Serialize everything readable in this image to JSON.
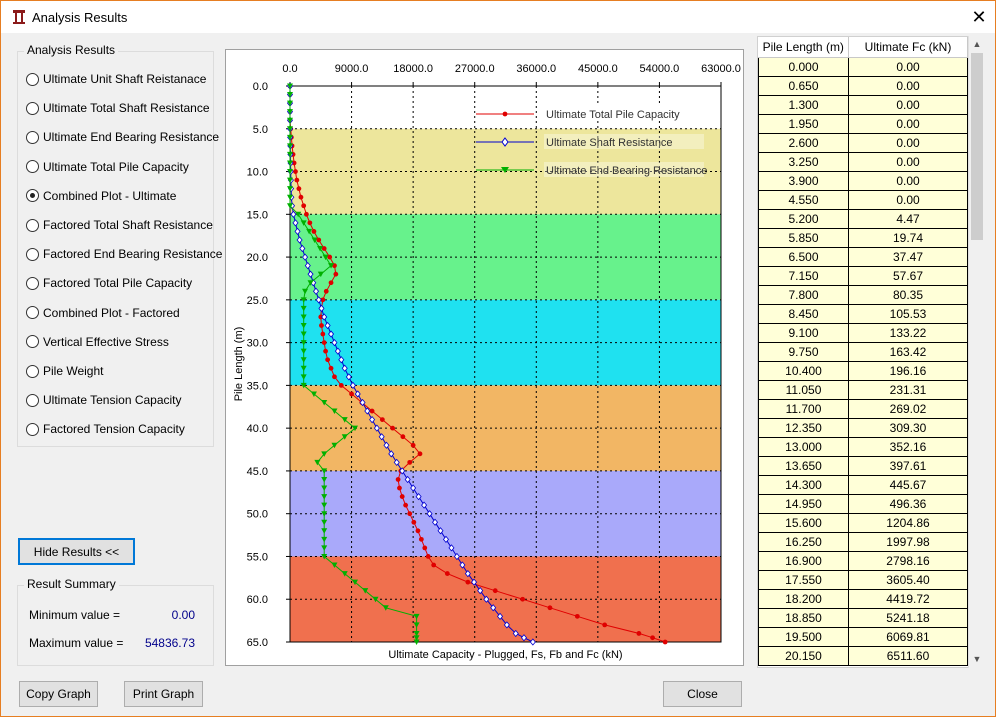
{
  "window": {
    "title": "Analysis Results",
    "close_glyph": "✕"
  },
  "results_group": {
    "legend": "Analysis Results",
    "options": [
      {
        "label": "Ultimate Unit Shaft Reistanace",
        "checked": false
      },
      {
        "label": "Ultimate Total Shaft Resistance",
        "checked": false
      },
      {
        "label": "Ultimate End Bearing Resistance",
        "checked": false
      },
      {
        "label": "Ultimate Total Pile Capacity",
        "checked": false
      },
      {
        "label": "Combined Plot - Ultimate",
        "checked": true
      },
      {
        "label": "Factored Total Shaft Resistance",
        "checked": false
      },
      {
        "label": "Factored End Bearing Resistance",
        "checked": false
      },
      {
        "label": "Factored Total Pile Capacity",
        "checked": false
      },
      {
        "label": "Combined Plot - Factored",
        "checked": false
      },
      {
        "label": "Vertical Effective Stress",
        "checked": false
      },
      {
        "label": "Pile Weight",
        "checked": false
      },
      {
        "label": "Ultimate Tension Capacity",
        "checked": false
      },
      {
        "label": "Factored Tension Capacity",
        "checked": false
      }
    ]
  },
  "hide_results_button": "Hide Results <<",
  "summary": {
    "legend": "Result Summary",
    "min_label": "Minimum value =",
    "min_value": "0.00",
    "max_label": "Maximum value =",
    "max_value": "54836.73"
  },
  "buttons": {
    "copy": "Copy Graph",
    "print": "Print Graph",
    "close": "Close"
  },
  "table": {
    "headers": [
      "Pile Length (m)",
      "Ultimate Fc (kN)"
    ],
    "rows": [
      [
        "0.000",
        "0.00"
      ],
      [
        "0.650",
        "0.00"
      ],
      [
        "1.300",
        "0.00"
      ],
      [
        "1.950",
        "0.00"
      ],
      [
        "2.600",
        "0.00"
      ],
      [
        "3.250",
        "0.00"
      ],
      [
        "3.900",
        "0.00"
      ],
      [
        "4.550",
        "0.00"
      ],
      [
        "5.200",
        "4.47"
      ],
      [
        "5.850",
        "19.74"
      ],
      [
        "6.500",
        "37.47"
      ],
      [
        "7.150",
        "57.67"
      ],
      [
        "7.800",
        "80.35"
      ],
      [
        "8.450",
        "105.53"
      ],
      [
        "9.100",
        "133.22"
      ],
      [
        "9.750",
        "163.42"
      ],
      [
        "10.400",
        "196.16"
      ],
      [
        "11.050",
        "231.31"
      ],
      [
        "11.700",
        "269.02"
      ],
      [
        "12.350",
        "309.30"
      ],
      [
        "13.000",
        "352.16"
      ],
      [
        "13.650",
        "397.61"
      ],
      [
        "14.300",
        "445.67"
      ],
      [
        "14.950",
        "496.36"
      ],
      [
        "15.600",
        "1204.86"
      ],
      [
        "16.250",
        "1997.98"
      ],
      [
        "16.900",
        "2798.16"
      ],
      [
        "17.550",
        "3605.40"
      ],
      [
        "18.200",
        "4419.72"
      ],
      [
        "18.850",
        "5241.18"
      ],
      [
        "19.500",
        "6069.81"
      ],
      [
        "20.150",
        "6511.60"
      ]
    ]
  },
  "chart_data": {
    "type": "line",
    "xlabel": "Ultimate Capacity - Plugged, Fs, Fb and Fc (kN)",
    "ylabel": "Pile Length (m)",
    "x_axis_position": "top",
    "y_inverted": true,
    "xlim": [
      0,
      63000
    ],
    "ylim": [
      0,
      65
    ],
    "x_ticks": [
      "0.0",
      "9000.0",
      "18000.0",
      "27000.0",
      "36000.0",
      "45000.0",
      "54000.0",
      "63000.0"
    ],
    "y_ticks": [
      "0.0",
      "5.0",
      "10.0",
      "15.0",
      "20.0",
      "25.0",
      "30.0",
      "35.0",
      "40.0",
      "45.0",
      "50.0",
      "55.0",
      "60.0",
      "65.0"
    ],
    "grid": "dashed",
    "legend_placement": "top-right",
    "layers": [
      {
        "from": 0,
        "to": 5,
        "color": "#ffffff"
      },
      {
        "from": 5,
        "to": 15,
        "color": "#ede69c"
      },
      {
        "from": 15,
        "to": 25,
        "color": "#67f28c"
      },
      {
        "from": 25,
        "to": 35,
        "color": "#1fe1f0"
      },
      {
        "from": 35,
        "to": 45,
        "color": "#f2b664"
      },
      {
        "from": 45,
        "to": 55,
        "color": "#a9a9fa"
      },
      {
        "from": 55,
        "to": 65,
        "color": "#f0704e"
      }
    ],
    "series": [
      {
        "name": "Ultimate Total Pile Capacity",
        "color": "#e00000",
        "marker": "circle",
        "x": [
          0,
          0,
          0,
          0,
          0,
          100,
          200,
          300,
          450,
          600,
          800,
          1000,
          1300,
          1600,
          2000,
          2400,
          2900,
          3500,
          4200,
          5000,
          5800,
          6500,
          6700,
          6000,
          5300,
          4800,
          4600,
          4500,
          4600,
          4800,
          5000,
          5200,
          5500,
          6000,
          6500,
          7500,
          9000,
          10500,
          12000,
          13500,
          15000,
          16500,
          18000,
          19000,
          17500,
          16200,
          15800,
          16000,
          16400,
          16900,
          17500,
          18100,
          18700,
          19200,
          19700,
          20200,
          21000,
          23000,
          26000,
          30000,
          34000,
          38000,
          42000,
          46000,
          51000,
          53000,
          54836.73
        ],
        "y": [
          0,
          1,
          2,
          3,
          4,
          5,
          6,
          7,
          8,
          9,
          10,
          11,
          12,
          13,
          14,
          15,
          16,
          17,
          18,
          19,
          20,
          21,
          22,
          23,
          24,
          25,
          26,
          27,
          28,
          29,
          30,
          31,
          32,
          33,
          34,
          35,
          36,
          37,
          38,
          39,
          40,
          41,
          42,
          43,
          44,
          45,
          46,
          47,
          48,
          49,
          50,
          51,
          52,
          53,
          54,
          55,
          56,
          57,
          58,
          59,
          60,
          61,
          62,
          63,
          64,
          64.5,
          65
        ]
      },
      {
        "name": "Ultimate Shaft Resistance",
        "color": "#0000d0",
        "marker": "diamond",
        "x": [
          0,
          0,
          0,
          0,
          0,
          5,
          20,
          40,
          60,
          80,
          100,
          130,
          160,
          200,
          300,
          500,
          800,
          1100,
          1400,
          1800,
          2200,
          2600,
          3000,
          3400,
          3800,
          4200,
          4600,
          5000,
          5500,
          6000,
          6500,
          7000,
          7500,
          8000,
          8600,
          9200,
          9900,
          10600,
          11300,
          12000,
          12700,
          13400,
          14100,
          14800,
          15600,
          16400,
          17200,
          18000,
          18800,
          19600,
          20400,
          21200,
          22000,
          22800,
          23600,
          24400,
          25200,
          26000,
          26900,
          27800,
          28700,
          29700,
          30700,
          31700,
          33000,
          34200,
          35500
        ],
        "y": [
          0,
          1,
          2,
          3,
          4,
          5,
          6,
          7,
          8,
          9,
          10,
          11,
          12,
          13,
          14,
          15,
          16,
          17,
          18,
          19,
          20,
          21,
          22,
          23,
          24,
          25,
          26,
          27,
          28,
          29,
          30,
          31,
          32,
          33,
          34,
          35,
          36,
          37,
          38,
          39,
          40,
          41,
          42,
          43,
          44,
          45,
          46,
          47,
          48,
          49,
          50,
          51,
          52,
          53,
          54,
          55,
          56,
          57,
          58,
          59,
          60,
          61,
          62,
          63,
          64,
          64.5,
          65
        ]
      },
      {
        "name": "Ultimate End Bearing Resistance",
        "color": "#00b000",
        "marker": "triangle",
        "x": [
          0,
          0,
          0,
          0,
          0,
          0,
          0,
          0,
          0,
          0,
          0,
          0,
          0,
          0,
          0,
          1200,
          2000,
          2800,
          3600,
          4400,
          5200,
          6000,
          4500,
          3000,
          2200,
          2000,
          2000,
          2000,
          2000,
          2000,
          2000,
          2000,
          2000,
          2000,
          2000,
          2000,
          3500,
          5000,
          6500,
          8000,
          9500,
          8000,
          6500,
          5000,
          4000,
          5000,
          5000,
          5000,
          5000,
          5000,
          5000,
          5000,
          5000,
          5000,
          5000,
          5000,
          6500,
          8000,
          9500,
          11000,
          12500,
          14000,
          18500,
          18500,
          18500,
          18500,
          18500
        ],
        "y": [
          0,
          1,
          2,
          3,
          4,
          5,
          6,
          7,
          8,
          9,
          10,
          11,
          12,
          13,
          14,
          15,
          16,
          17,
          18,
          19,
          20,
          21,
          22,
          23,
          24,
          25,
          26,
          27,
          28,
          29,
          30,
          31,
          32,
          33,
          34,
          35,
          36,
          37,
          38,
          39,
          40,
          41,
          42,
          43,
          44,
          45,
          46,
          47,
          48,
          49,
          50,
          51,
          52,
          53,
          54,
          55,
          56,
          57,
          58,
          59,
          60,
          61,
          62,
          63,
          64,
          64.5,
          65
        ]
      }
    ]
  }
}
